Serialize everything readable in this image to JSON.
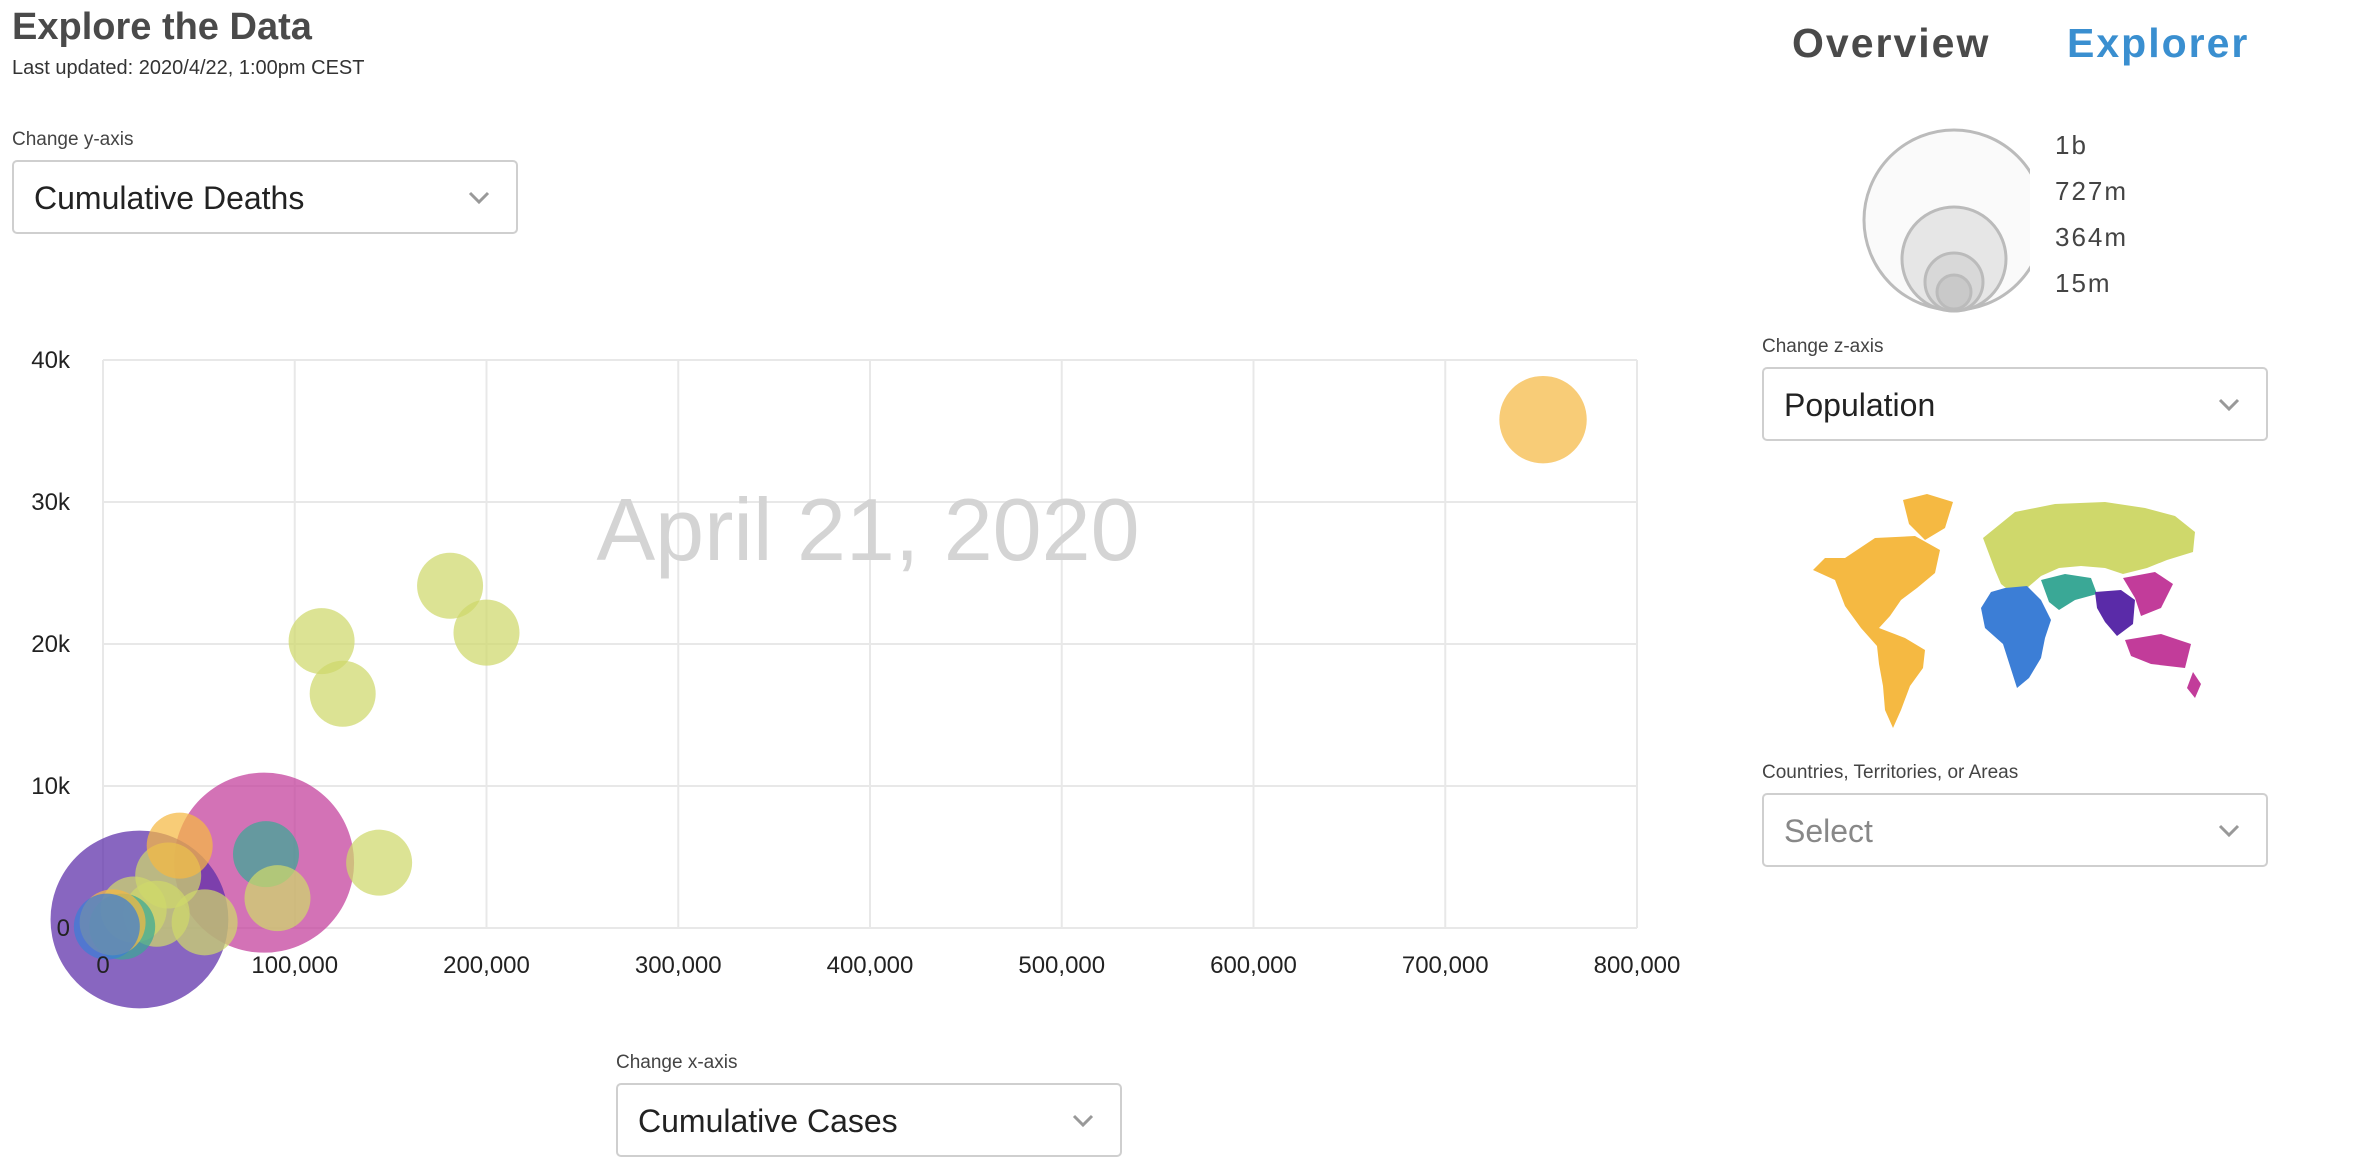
{
  "header": {
    "title": "Explore the Data",
    "last_updated": "Last updated: 2020/4/22, 1:00pm CEST"
  },
  "nav": {
    "overview": "Overview",
    "explorer": "Explorer",
    "active_color": "#3a8fd0"
  },
  "controls": {
    "y_axis": {
      "label": "Change y-axis",
      "value": "Cumulative Deaths"
    },
    "x_axis": {
      "label": "Change x-axis",
      "value": "Cumulative Cases"
    },
    "z_axis": {
      "label": "Change z-axis",
      "value": "Population"
    },
    "countries": {
      "label": "Countries, Territories, or Areas",
      "placeholder": "Select"
    }
  },
  "size_legend": [
    "1b",
    "727m",
    "364m",
    "15m"
  ],
  "region_colors": {
    "americas": "#f5b942",
    "europe": "#cfd86b",
    "africa": "#3c7ed6",
    "eastern_mediterranean": "#3aa896",
    "south_east_asia": "#5a2ba8",
    "western_pacific": "#c23c9a"
  },
  "chart_data": {
    "type": "scatter",
    "annotation": "April 21, 2020",
    "xlabel": "",
    "ylabel": "",
    "xlim": [
      0,
      800000
    ],
    "ylim": [
      0,
      40000
    ],
    "x_ticks": [
      "0",
      "100,000",
      "200,000",
      "300,000",
      "400,000",
      "500,000",
      "600,000",
      "700,000",
      "800,000"
    ],
    "y_ticks": [
      "0",
      "10k",
      "20k",
      "30k",
      "40k"
    ],
    "grid": true,
    "points": [
      {
        "x": 19000,
        "y": 600,
        "population": 1366000000,
        "region": "south_east_asia"
      },
      {
        "x": 84000,
        "y": 4600,
        "population": 1400000000,
        "region": "western_pacific"
      },
      {
        "x": 751000,
        "y": 35800,
        "population": 330000000,
        "region": "americas"
      },
      {
        "x": 181000,
        "y": 24100,
        "population": 15000000,
        "region": "europe"
      },
      {
        "x": 114000,
        "y": 20200,
        "population": 15000000,
        "region": "europe"
      },
      {
        "x": 200000,
        "y": 20800,
        "population": 15000000,
        "region": "europe"
      },
      {
        "x": 125000,
        "y": 16500,
        "population": 15000000,
        "region": "europe"
      },
      {
        "x": 144000,
        "y": 4600,
        "population": 15000000,
        "region": "europe"
      },
      {
        "x": 85000,
        "y": 5200,
        "population": 15000000,
        "region": "eastern_mediterranean"
      },
      {
        "x": 91000,
        "y": 2100,
        "population": 15000000,
        "region": "europe"
      },
      {
        "x": 53000,
        "y": 400,
        "population": 15000000,
        "region": "europe"
      },
      {
        "x": 34000,
        "y": 3700,
        "population": 15000000,
        "region": "europe"
      },
      {
        "x": 40000,
        "y": 5800,
        "population": 15000000,
        "region": "americas"
      },
      {
        "x": 28000,
        "y": 1000,
        "population": 15000000,
        "region": "europe"
      },
      {
        "x": 16000,
        "y": 1300,
        "population": 15000000,
        "region": "europe"
      },
      {
        "x": 10000,
        "y": 100,
        "population": 15000000,
        "region": "eastern_mediterranean"
      },
      {
        "x": 5000,
        "y": 400,
        "population": 15000000,
        "region": "americas"
      },
      {
        "x": 2000,
        "y": 100,
        "population": 15000000,
        "region": "africa"
      }
    ]
  }
}
